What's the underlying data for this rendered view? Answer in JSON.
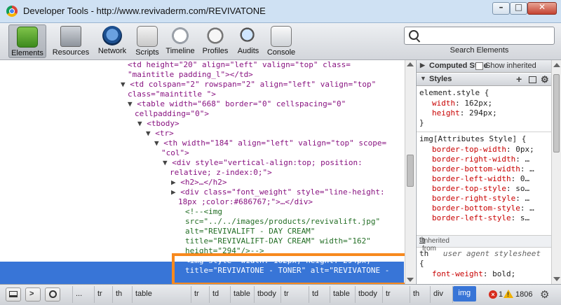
{
  "window": {
    "title": "Developer Tools - http://www.revivaderm.com/REVIVATONE",
    "min_glyph": "–",
    "max_glyph": "□",
    "close_glyph": "✕"
  },
  "toolbar": {
    "tools": [
      {
        "label": "Elements",
        "icon": "elements-icon",
        "active": true
      },
      {
        "label": "Resources",
        "icon": "resources-icon"
      },
      {
        "label": "Network",
        "icon": "network-icon"
      },
      {
        "label": "Scripts",
        "icon": "scripts-icon"
      },
      {
        "label": "Timeline",
        "icon": "timeline-icon"
      },
      {
        "label": "Profiles",
        "icon": "profiles-icon"
      },
      {
        "label": "Audits",
        "icon": "audits-icon"
      },
      {
        "label": "Console",
        "icon": "console-icon"
      }
    ],
    "search_label": "Search Elements",
    "search_value": ""
  },
  "dom": {
    "lines": [
      {
        "indent": 0,
        "text": "<td height=\"20\" align=\"left\" valign=\"top\" class="
      },
      {
        "indent": 0,
        "text": "\"maintitle padding_l\"></td>"
      },
      {
        "indent": 0,
        "tri": "▼",
        "text": "<td colspan=\"2\" rowspan=\"2\" align=\"left\" valign=\"top\""
      },
      {
        "indent": 0,
        "text": "class=\"maintitle \">"
      },
      {
        "indent": 1,
        "tri": "▼",
        "text": "<table width=\"668\" border=\"0\" cellspacing=\"0\""
      },
      {
        "indent": 1,
        "text": "cellpadding=\"0\">"
      },
      {
        "indent": 2,
        "tri": "▼",
        "text": "<tbody>"
      },
      {
        "indent": 3,
        "tri": "▼",
        "text": "<tr>"
      },
      {
        "indent": 4,
        "tri": "▼",
        "text": "<th width=\"184\" align=\"left\" valign=\"top\" scope="
      },
      {
        "indent": 4,
        "text": "\"col\">"
      },
      {
        "indent": 5,
        "tri": "▼",
        "text": "<div style=\"vertical-align:top; position:"
      },
      {
        "indent": 5,
        "text": "relative; z-index:0;\">"
      },
      {
        "indent": 6,
        "tri": "▶",
        "text": "<h2>…</h2>"
      },
      {
        "indent": 6,
        "tri": "▶",
        "text": "<div class=\"font_weight\" style=\"line-height:"
      },
      {
        "indent": 6,
        "text": "18px ;color:#686767;\">…</div>"
      },
      {
        "indent": 7,
        "text": "<!--<img",
        "comment": true
      },
      {
        "indent": 7,
        "text": "src=\"../../images/products/revivalift.jpg\"",
        "comment": true
      },
      {
        "indent": 7,
        "text": "alt=\"REVIVALIFT - DAY CREAM\"",
        "comment": true
      },
      {
        "indent": 7,
        "text": "title=\"REVIVALIFT-DAY CREAM\" width=\"162\"",
        "comment": true
      },
      {
        "indent": 7,
        "text": "height=\"294\"/>-->",
        "comment": true
      },
      {
        "indent": 7,
        "text": "<img style=\"width: 162px; height: 294px;\"",
        "selected": true
      },
      {
        "indent": 7,
        "text": "title=\"REVIVATONE - TONER\" alt=\"REVIVATONE -",
        "selected": true
      }
    ]
  },
  "sidebar": {
    "computed_style": "Computed Style",
    "show_inherited": "Show inherited",
    "styles": "Styles",
    "element_style": {
      "selector": "element.style {",
      "props": [
        {
          "name": "width",
          "value": "162px;"
        },
        {
          "name": "height",
          "value": "294px;"
        }
      ],
      "close": "}"
    },
    "attr_style": {
      "selector": "img[Attributes Style] {",
      "props": [
        {
          "name": "border-top-width",
          "value": "0px;"
        },
        {
          "name": "border-right-width",
          "value": "…"
        },
        {
          "name": "border-bottom-width",
          "value": "…"
        },
        {
          "name": "border-left-width",
          "value": "0…"
        },
        {
          "name": "border-top-style",
          "value": "so…"
        },
        {
          "name": "border-right-style",
          "value": "…"
        },
        {
          "name": "border-bottom-style",
          "value": "…"
        },
        {
          "name": "border-left-style",
          "value": "s…"
        }
      ]
    },
    "inherited_from": "Inherited from",
    "inherited_tag": "th",
    "ua_selector": "th",
    "ua_label": "user agent stylesheet",
    "ua_open": "{",
    "ua_prop": "font-weight",
    "ua_value": "bold;"
  },
  "statusbar": {
    "crumbs": [
      "...",
      "tr",
      "th",
      "table",
      "tr",
      "td",
      "table",
      "tbody",
      "tr",
      "td",
      "table",
      "tbody",
      "tr",
      "th",
      "div",
      "img"
    ],
    "selected_crumb": "img",
    "errors": "1",
    "warnings": "1806"
  },
  "colors": {
    "selection": "#3875d7",
    "highlight_border": "#f7891e",
    "tag": "#881280",
    "attr": "#994500",
    "value": "#1a1aa6",
    "comment": "#236e25",
    "css_prop": "#c80000"
  }
}
